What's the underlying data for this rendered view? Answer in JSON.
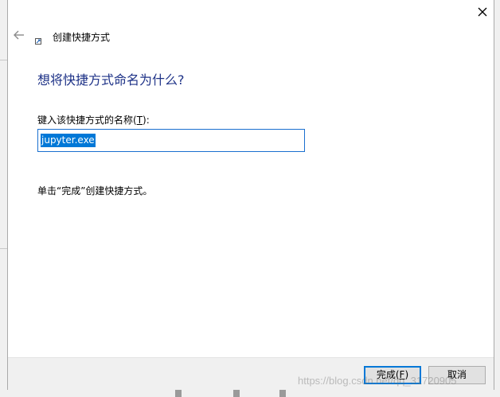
{
  "window": {
    "title": "创建快捷方式"
  },
  "heading": "想将快捷方式命名为什么?",
  "name_field": {
    "label": "键入该快捷方式的名称(",
    "accel": "T",
    "label_end": "):",
    "value": "jupyter.exe"
  },
  "hint": "单击“完成”创建快捷方式。",
  "buttons": {
    "finish_label": "完成(",
    "finish_accel": "F",
    "finish_end": ")",
    "cancel_label": "取消"
  },
  "watermark": "https://blog.csdn.net/qq_31720905",
  "icons": {
    "close": "close-icon",
    "back": "back-arrow-icon",
    "shortcut": "shortcut-icon"
  },
  "colors": {
    "heading": "#1e3287",
    "selection": "#0078d7",
    "input_border": "#1a6fcf"
  }
}
